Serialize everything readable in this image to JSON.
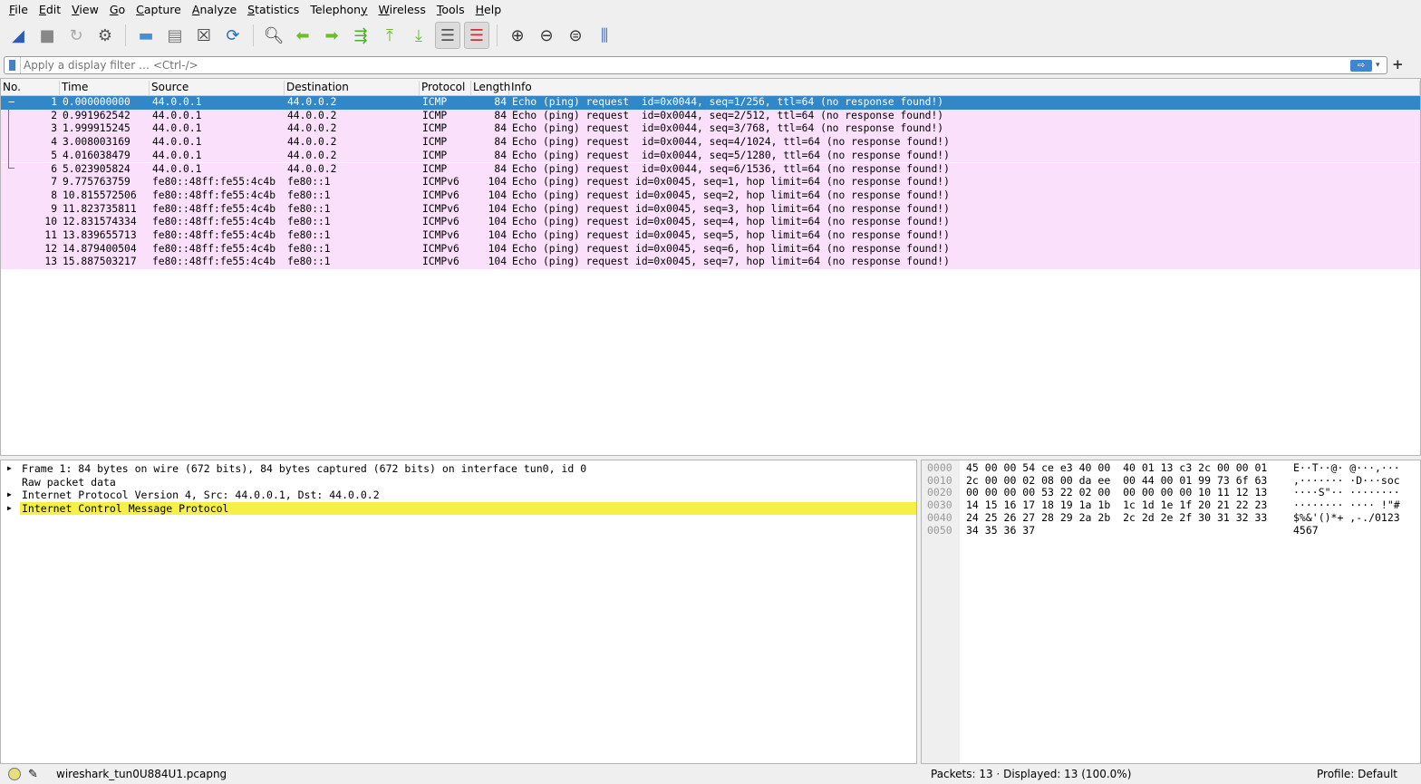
{
  "menu": [
    {
      "pre": "",
      "u": "F",
      "post": "ile"
    },
    {
      "pre": "",
      "u": "E",
      "post": "dit"
    },
    {
      "pre": "",
      "u": "V",
      "post": "iew"
    },
    {
      "pre": "",
      "u": "G",
      "post": "o"
    },
    {
      "pre": "",
      "u": "C",
      "post": "apture"
    },
    {
      "pre": "",
      "u": "A",
      "post": "nalyze"
    },
    {
      "pre": "",
      "u": "S",
      "post": "tatistics"
    },
    {
      "pre": "Telephon",
      "u": "y",
      "post": ""
    },
    {
      "pre": "",
      "u": "W",
      "post": "ireless"
    },
    {
      "pre": "",
      "u": "T",
      "post": "ools"
    },
    {
      "pre": "",
      "u": "H",
      "post": "elp"
    }
  ],
  "toolbar": [
    {
      "name": "start-capture",
      "glyph": "◢",
      "color": "#2a5db0"
    },
    {
      "name": "stop-capture",
      "glyph": "■",
      "color": "#888"
    },
    {
      "name": "restart-capture",
      "glyph": "↻",
      "color": "#aaa"
    },
    {
      "name": "capture-options",
      "glyph": "⚙",
      "color": "#555"
    },
    "sep",
    {
      "name": "open-file",
      "glyph": "▬",
      "color": "#4a8fd6"
    },
    {
      "name": "save-file",
      "glyph": "▤",
      "color": "#777"
    },
    {
      "name": "close-file",
      "glyph": "☒",
      "color": "#444"
    },
    {
      "name": "reload-file",
      "glyph": "⟳",
      "color": "#2a6db8"
    },
    "sep",
    {
      "name": "find-packet",
      "glyph": "🔍︎",
      "color": "#333"
    },
    {
      "name": "go-back",
      "glyph": "⬅",
      "color": "#6cbf2a"
    },
    {
      "name": "go-forward",
      "glyph": "➡",
      "color": "#6cbf2a"
    },
    {
      "name": "go-to-packet",
      "glyph": "⇶",
      "color": "#4caf2a"
    },
    {
      "name": "go-first",
      "glyph": "⤒",
      "color": "#6cbf2a"
    },
    {
      "name": "go-last",
      "glyph": "⤓",
      "color": "#6cbf2a"
    },
    {
      "name": "autoscroll",
      "glyph": "☰",
      "color": "#555",
      "on": true
    },
    {
      "name": "colorize",
      "glyph": "☰",
      "color": "#c33",
      "on": true
    },
    "sep",
    {
      "name": "zoom-in",
      "glyph": "⊕",
      "color": "#333"
    },
    {
      "name": "zoom-out",
      "glyph": "⊖",
      "color": "#333"
    },
    {
      "name": "zoom-normal",
      "glyph": "⊜",
      "color": "#333"
    },
    {
      "name": "resize-columns",
      "glyph": "⫼",
      "color": "#3a6db8"
    }
  ],
  "filter": {
    "placeholder": "Apply a display filter … <Ctrl-/>",
    "apply": "⇨",
    "dropdown": "▾",
    "add": "+"
  },
  "columns": [
    "No.",
    "Time",
    "Source",
    "Destination",
    "Protocol",
    "Length",
    "Info"
  ],
  "packets": [
    [
      "1",
      "0.000000000",
      "44.0.0.1",
      "44.0.0.2",
      "ICMP",
      "84",
      "Echo (ping) request  id=0x0044, seq=1/256, ttl=64 (no response found!)"
    ],
    [
      "2",
      "0.991962542",
      "44.0.0.1",
      "44.0.0.2",
      "ICMP",
      "84",
      "Echo (ping) request  id=0x0044, seq=2/512, ttl=64 (no response found!)"
    ],
    [
      "3",
      "1.999915245",
      "44.0.0.1",
      "44.0.0.2",
      "ICMP",
      "84",
      "Echo (ping) request  id=0x0044, seq=3/768, ttl=64 (no response found!)"
    ],
    [
      "4",
      "3.008003169",
      "44.0.0.1",
      "44.0.0.2",
      "ICMP",
      "84",
      "Echo (ping) request  id=0x0044, seq=4/1024, ttl=64 (no response found!)"
    ],
    [
      "5",
      "4.016038479",
      "44.0.0.1",
      "44.0.0.2",
      "ICMP",
      "84",
      "Echo (ping) request  id=0x0044, seq=5/1280, ttl=64 (no response found!)"
    ],
    [
      "6",
      "5.023905824",
      "44.0.0.1",
      "44.0.0.2",
      "ICMP",
      "84",
      "Echo (ping) request  id=0x0044, seq=6/1536, ttl=64 (no response found!)"
    ],
    [
      "7",
      "9.775763759",
      "fe80::48ff:fe55:4c4b",
      "fe80::1",
      "ICMPv6",
      "104",
      "Echo (ping) request id=0x0045, seq=1, hop limit=64 (no response found!)"
    ],
    [
      "8",
      "10.815572506",
      "fe80::48ff:fe55:4c4b",
      "fe80::1",
      "ICMPv6",
      "104",
      "Echo (ping) request id=0x0045, seq=2, hop limit=64 (no response found!)"
    ],
    [
      "9",
      "11.823735811",
      "fe80::48ff:fe55:4c4b",
      "fe80::1",
      "ICMPv6",
      "104",
      "Echo (ping) request id=0x0045, seq=3, hop limit=64 (no response found!)"
    ],
    [
      "10",
      "12.831574334",
      "fe80::48ff:fe55:4c4b",
      "fe80::1",
      "ICMPv6",
      "104",
      "Echo (ping) request id=0x0045, seq=4, hop limit=64 (no response found!)"
    ],
    [
      "11",
      "13.839655713",
      "fe80::48ff:fe55:4c4b",
      "fe80::1",
      "ICMPv6",
      "104",
      "Echo (ping) request id=0x0045, seq=5, hop limit=64 (no response found!)"
    ],
    [
      "12",
      "14.879400504",
      "fe80::48ff:fe55:4c4b",
      "fe80::1",
      "ICMPv6",
      "104",
      "Echo (ping) request id=0x0045, seq=6, hop limit=64 (no response found!)"
    ],
    [
      "13",
      "15.887503217",
      "fe80::48ff:fe55:4c4b",
      "fe80::1",
      "ICMPv6",
      "104",
      "Echo (ping) request id=0x0045, seq=7, hop limit=64 (no response found!)"
    ]
  ],
  "selected_packet": "1",
  "tree": [
    {
      "text": "Frame 1: 84 bytes on wire (672 bits), 84 bytes captured (672 bits) on interface tun0, id 0",
      "expandable": true
    },
    {
      "text": "Raw packet data",
      "expandable": false
    },
    {
      "text": "Internet Protocol Version 4, Src: 44.0.0.1, Dst: 44.0.0.2",
      "expandable": true
    },
    {
      "text": "Internet Control Message Protocol",
      "expandable": true,
      "highlighted": true
    }
  ],
  "bytes": [
    {
      "off": "0000",
      "hex": "45 00 00 54 ce e3 40 00  40 01 13 c3 2c 00 00 01",
      "ascii": "E··T··@· @···,···"
    },
    {
      "off": "0010",
      "hex": "2c 00 00 02 08 00 da ee  00 44 00 01 99 73 6f 63",
      "ascii": ",······· ·D···soc"
    },
    {
      "off": "0020",
      "hex": "00 00 00 00 53 22 02 00  00 00 00 00 10 11 12 13",
      "ascii": "····S\"·· ········"
    },
    {
      "off": "0030",
      "hex": "14 15 16 17 18 19 1a 1b  1c 1d 1e 1f 20 21 22 23",
      "ascii": "········ ···· !\"#"
    },
    {
      "off": "0040",
      "hex": "24 25 26 27 28 29 2a 2b  2c 2d 2e 2f 30 31 32 33",
      "ascii": "$%&'()*+ ,-./0123"
    },
    {
      "off": "0050",
      "hex": "34 35 36 37",
      "ascii": "4567"
    }
  ],
  "status": {
    "file": "wireshark_tun0U884U1.pcapng",
    "packets": "Packets: 13 · Displayed: 13 (100.0%)",
    "profile": "Profile: Default"
  }
}
